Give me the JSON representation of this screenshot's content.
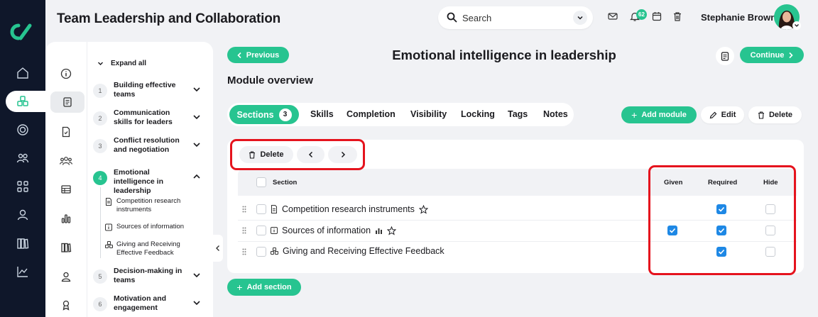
{
  "header": {
    "title": "Team Leadership and Collaboration",
    "search_placeholder": "Search",
    "notification_count": "62",
    "user_name": "Stephanie Brown"
  },
  "sidebar": {
    "expand_all": "Expand all",
    "modules": [
      {
        "num": "1",
        "title": "Building effective teams",
        "expanded": false
      },
      {
        "num": "2",
        "title": "Communication skills for leaders",
        "expanded": false
      },
      {
        "num": "3",
        "title": "Conflict resolution and negotiation",
        "expanded": false
      },
      {
        "num": "4",
        "title": "Emotional intelligence in leadership",
        "expanded": true
      },
      {
        "num": "5",
        "title": "Decision-making in teams",
        "expanded": false
      },
      {
        "num": "6",
        "title": "Motivation and engagement",
        "expanded": false
      }
    ],
    "subsections": [
      {
        "title": "Competition research instruments",
        "icon": "document-icon"
      },
      {
        "title": "Sources of information",
        "icon": "info-box-icon"
      },
      {
        "title": "Giving and Receiving Effective Feedback",
        "icon": "cubes-icon"
      }
    ]
  },
  "nav": {
    "previous": "Previous",
    "continue": "Continue",
    "page_title": "Emotional intelligence in leadership"
  },
  "overview": {
    "heading": "Module overview",
    "tabs": [
      {
        "label": "Sections",
        "count": "3",
        "active": true
      },
      {
        "label": "Skills"
      },
      {
        "label": "Completion"
      },
      {
        "label": "Visibility"
      },
      {
        "label": "Locking"
      },
      {
        "label": "Tags"
      },
      {
        "label": "Notes"
      }
    ],
    "add_module": "Add module",
    "edit": "Edit",
    "delete": "Delete"
  },
  "table": {
    "toolbar_delete": "Delete",
    "columns": {
      "section": "Section",
      "given": "Given",
      "required": "Required",
      "hide": "Hide"
    },
    "rows": [
      {
        "title": "Competition research instruments",
        "given": false,
        "required": true,
        "hide": false
      },
      {
        "title": "Sources of information",
        "given": true,
        "required": true,
        "hide": false
      },
      {
        "title": "Giving and Receiving Effective Feedback",
        "given": false,
        "required": true,
        "hide": false
      }
    ],
    "add_section": "Add section"
  },
  "colors": {
    "accent": "#27c490",
    "rail": "#0f172a",
    "checkbox": "#1e88e5",
    "highlight": "#e5131d"
  }
}
